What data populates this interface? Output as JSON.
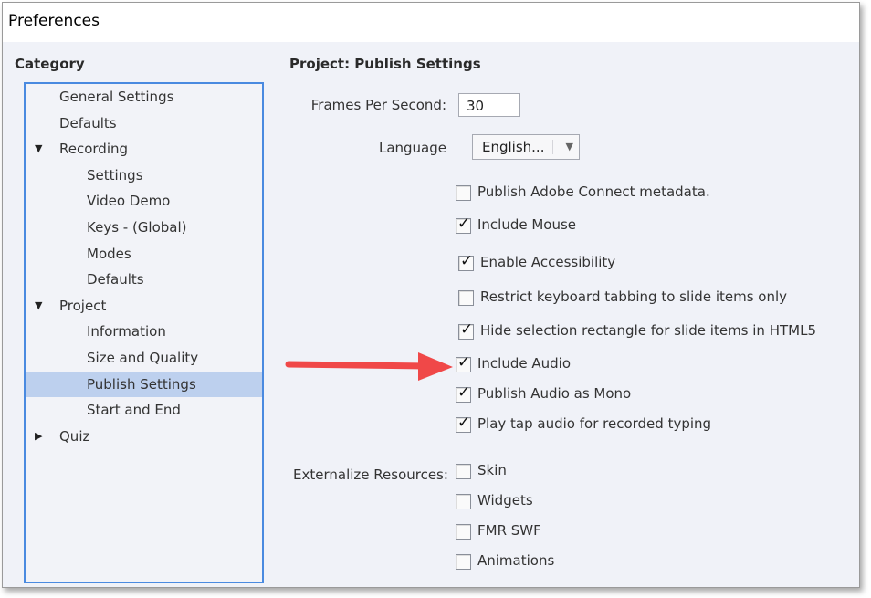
{
  "window": {
    "title": "Preferences"
  },
  "category": {
    "header": "Category",
    "items": [
      {
        "label": "General Settings",
        "level": 0,
        "expander": "none"
      },
      {
        "label": "Defaults",
        "level": 0,
        "expander": "none"
      },
      {
        "label": "Recording",
        "level": 0,
        "expander": "expanded"
      },
      {
        "label": "Settings",
        "level": 1,
        "expander": "none"
      },
      {
        "label": "Video Demo",
        "level": 1,
        "expander": "none"
      },
      {
        "label": "Keys - (Global)",
        "level": 1,
        "expander": "none"
      },
      {
        "label": "Modes",
        "level": 1,
        "expander": "none"
      },
      {
        "label": "Defaults",
        "level": 1,
        "expander": "none"
      },
      {
        "label": "Project",
        "level": 0,
        "expander": "expanded"
      },
      {
        "label": "Information",
        "level": 1,
        "expander": "none"
      },
      {
        "label": "Size and Quality",
        "level": 1,
        "expander": "none"
      },
      {
        "label": "Publish Settings",
        "level": 1,
        "expander": "none",
        "selected": true
      },
      {
        "label": "Start and End",
        "level": 1,
        "expander": "none"
      },
      {
        "label": "Quiz",
        "level": 0,
        "expander": "collapsed"
      }
    ]
  },
  "main": {
    "header": "Project: Publish Settings",
    "fps": {
      "label": "Frames Per Second:",
      "value": "30"
    },
    "language": {
      "label": "Language",
      "value": "English..."
    },
    "options": [
      {
        "label": "Publish Adobe Connect metadata.",
        "checked": false
      },
      {
        "label": "Include Mouse",
        "checked": true
      },
      {
        "label": "Enable Accessibility",
        "checked": true
      },
      {
        "label": "Restrict keyboard tabbing to slide items only",
        "checked": false
      },
      {
        "label": "Hide selection rectangle for slide items in HTML5",
        "checked": true
      },
      {
        "label": "Include Audio",
        "checked": true
      },
      {
        "label": "Publish Audio as Mono",
        "checked": true
      },
      {
        "label": "Play tap audio for recorded typing",
        "checked": true
      }
    ],
    "externalize": {
      "label": "Externalize Resources:",
      "items": [
        {
          "label": "Skin",
          "checked": false
        },
        {
          "label": "Widgets",
          "checked": false
        },
        {
          "label": "FMR SWF",
          "checked": false
        },
        {
          "label": "Animations",
          "checked": false
        }
      ]
    }
  },
  "annotation": {
    "arrow_color": "#f04848",
    "points_to": "Include Audio"
  },
  "colors": {
    "selection": "#bdd0ee",
    "tree_border": "#4a8ae0",
    "background": "#f0f2f8"
  }
}
